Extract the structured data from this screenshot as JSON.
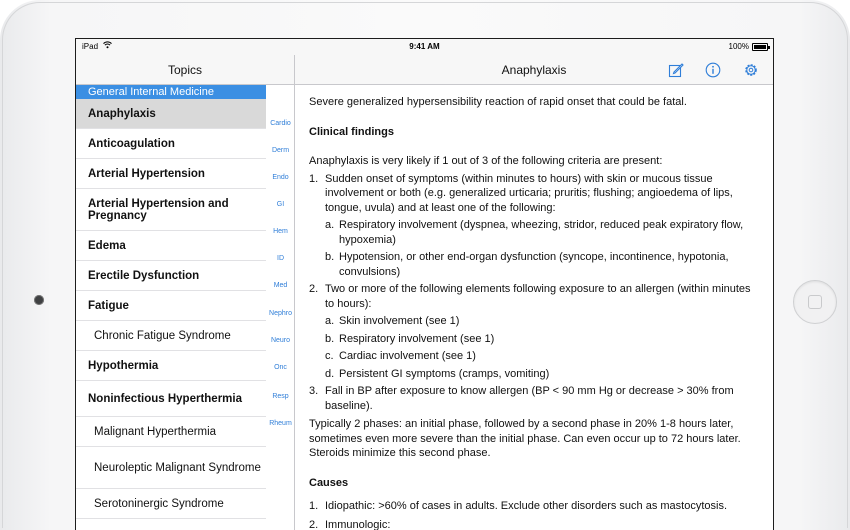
{
  "status": {
    "carrier": "iPad",
    "time": "9:41 AM",
    "battery": "100%",
    "battery_level": 1.0
  },
  "sidebar": {
    "title": "Topics",
    "section_header": "General Internal Medicine",
    "items": [
      {
        "label": "Anaphylaxis",
        "style": "bold",
        "selected": true
      },
      {
        "label": "Anticoagulation",
        "style": "bold"
      },
      {
        "label": "Arterial Hypertension",
        "style": "bold"
      },
      {
        "label": "Arterial Hypertension and Pregnancy",
        "style": "bold"
      },
      {
        "label": "Edema",
        "style": "bold"
      },
      {
        "label": "Erectile Dysfunction",
        "style": "bold"
      },
      {
        "label": "Fatigue",
        "style": "bold"
      },
      {
        "label": "Chronic Fatigue Syndrome",
        "style": "sub"
      },
      {
        "label": "Hypothermia",
        "style": "bold"
      },
      {
        "label": "Noninfectious Hyperthermia",
        "style": "bold"
      },
      {
        "label": "Malignant Hyperthermia",
        "style": "sub"
      },
      {
        "label": "Neuroleptic Malignant Syndrome",
        "style": "sub"
      },
      {
        "label": "Serotoninergic Syndrome",
        "style": "sub"
      }
    ],
    "index": [
      "Cardio",
      "Derm",
      "Endo",
      "GI",
      "Hem",
      "ID",
      "Med",
      "Nephro",
      "Neuro",
      "Onc",
      "Resp",
      "Rheum"
    ]
  },
  "detail": {
    "title": "Anaphylaxis",
    "icons": [
      "compose-icon",
      "info-icon",
      "settings-icon"
    ],
    "intro": "Severe generalized hypersensibility reaction of rapid onset that could be fatal.",
    "clinical_heading": "Clinical findings",
    "clinical_lead": "Anaphylaxis is very likely if 1 out of 3 of the following criteria are present:",
    "criteria": [
      {
        "num": "1.",
        "text": "Sudden onset of symptoms (within minutes to hours) with skin or mucous tissue involvement or both (e.g. generalized urticaria; pruritis; flushing; angioedema of lips, tongue, uvula) and at least one of the following:",
        "sub": [
          {
            "num": "a.",
            "text": "Respiratory involvement (dyspnea, wheezing, stridor, reduced peak expiratory flow, hypoxemia)"
          },
          {
            "num": "b.",
            "text": "Hypotension, or other end-organ dysfunction (syncope, incontinence, hypotonia, convulsions)"
          }
        ]
      },
      {
        "num": "2.",
        "text": "Two or more of the following elements following exposure to an allergen (within minutes to hours):",
        "sub": [
          {
            "num": "a.",
            "text": "Skin involvement (see 1)"
          },
          {
            "num": "b.",
            "text": "Respiratory involvement (see 1)"
          },
          {
            "num": "c.",
            "text": "Cardiac involvement (see 1)"
          },
          {
            "num": "d.",
            "text": "Persistent GI symptoms (cramps, vomiting)"
          }
        ]
      },
      {
        "num": "3.",
        "text": "Fall in BP after exposure to know allergen (BP < 90 mm Hg or decrease > 30% from baseline).",
        "sub": []
      }
    ],
    "phases": "Typically 2 phases: an initial phase, followed by a second phase in 20% 1-8 hours later, sometimes even more severe than the initial phase. Can even occur up to 72 hours later. Steroids minimize this second phase.",
    "causes_heading": "Causes",
    "causes": [
      {
        "num": "1.",
        "text": "Idiopathic: >60% of cases in adults. Exclude other disorders such as mastocytosis."
      },
      {
        "num": "2.",
        "text": "Immunologic:"
      }
    ]
  },
  "colors": {
    "accent": "#2f7ed8",
    "section_header": "#3b8fe3",
    "selected_row": "#d9d9d9"
  }
}
